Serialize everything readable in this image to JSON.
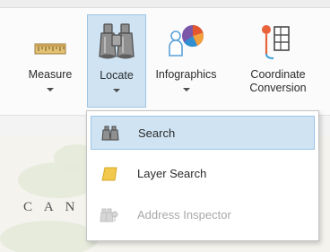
{
  "ribbon": {
    "buttons": [
      {
        "label": "Measure",
        "icon": "ruler-icon",
        "has_dropdown": true
      },
      {
        "label": "Locate",
        "icon": "binoculars-icon",
        "has_dropdown": true,
        "active": true
      },
      {
        "label": "Infographics",
        "icon": "infographics-icon",
        "has_dropdown": true
      },
      {
        "label_line1": "Coordinate",
        "label_line2": "Conversion",
        "icon": "coordinate-conversion-icon"
      }
    ]
  },
  "locate_menu": {
    "items": [
      {
        "label": "Search",
        "icon": "binoculars-icon",
        "highlighted": true,
        "enabled": true
      },
      {
        "label": "Layer Search",
        "icon": "layer-icon",
        "enabled": true
      },
      {
        "label": "Address Inspector",
        "icon": "address-inspector-icon",
        "enabled": false
      }
    ]
  },
  "map": {
    "label": "C A N"
  },
  "colors": {
    "active_bg": "#cfe3f3",
    "active_border": "#9ec5e5",
    "disabled_text": "#a8a8a8",
    "layer_icon": "#f2c94c"
  }
}
